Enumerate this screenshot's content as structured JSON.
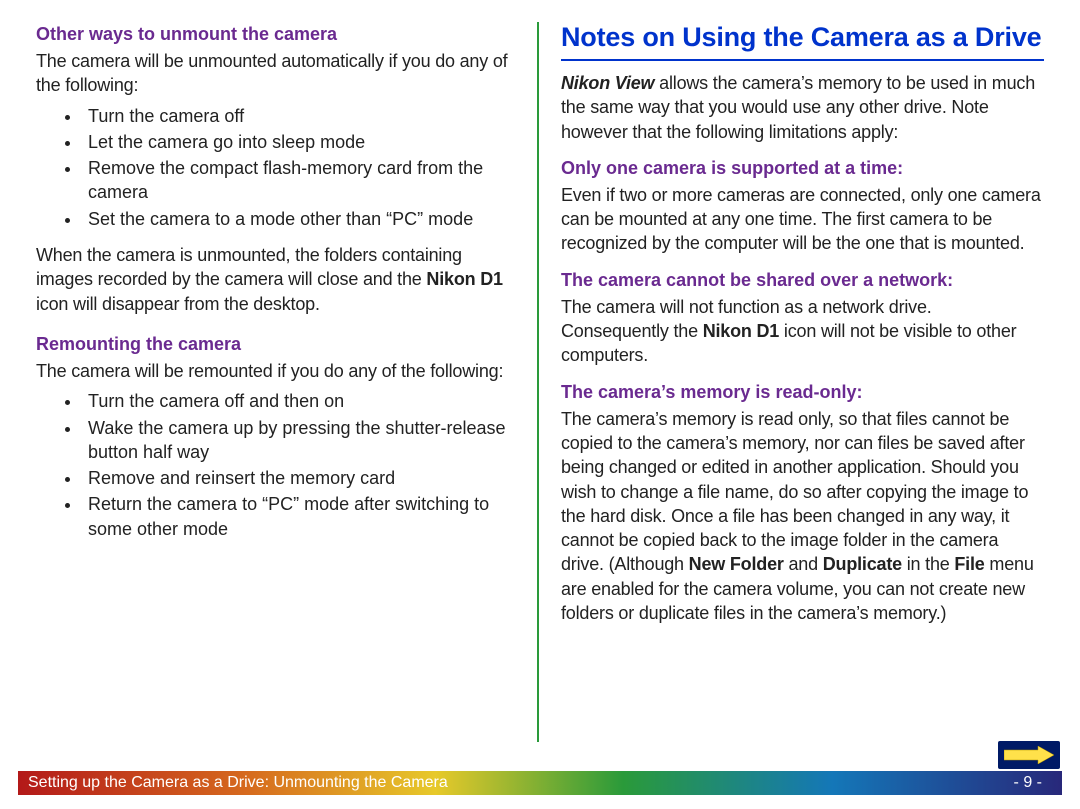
{
  "left": {
    "section1": {
      "heading": "Other ways to unmount the camera",
      "intro": "The camera will be unmounted automatically if you do any of the following:",
      "bullets": [
        "Turn the camera off",
        "Let the camera go into sleep mode",
        "Remove the compact flash-memory card from the camera",
        "Set the camera to a mode other than “PC” mode"
      ],
      "after_pre": "When the camera is unmounted, the folders containing images recorded by the camera will close and the ",
      "after_bold": "Nikon D1",
      "after_post": " icon will disappear from the desktop."
    },
    "section2": {
      "heading": "Remounting the camera",
      "intro": "The camera will be remounted if you do any of the following:",
      "bullets": [
        "Turn the camera off and then on",
        "Wake the camera up by pressing the shutter-release button half way",
        "Remove and reinsert the memory card",
        "Return the camera to “PC” mode after switching to some other mode"
      ]
    }
  },
  "right": {
    "title": "Notes on Using the Camera as a Drive",
    "intro_italic": "Nikon View",
    "intro_rest": " allows the camera’s memory to be used in much the same way that you would use any other drive.  Note however that the following limitations apply:",
    "s1": {
      "heading": "Only one camera is supported at a time:",
      "body": "Even if two or more cameras are connected, only one camera can be mounted at any one time. The first camera to be recognized by the computer will be the one that is mounted."
    },
    "s2": {
      "heading": "The camera cannot be shared over a network:",
      "body_pre": "The camera will not function as a network drive.  Consequently the ",
      "body_bold": "Nikon D1",
      "body_post": " icon will not be visible to other computers."
    },
    "s3": {
      "heading": "The camera’s memory is read-only:",
      "body_pre": "The camera’s memory is read only, so that files cannot be copied to the camera’s memory, nor can files be saved after being changed or edited in another application. Should you wish to change a file name, do so after copying the image to the hard disk. Once a file has been changed in any way, it cannot be copied back to the image folder in the camera drive.  (Although ",
      "body_b1": "New Folder",
      "body_mid1": " and ",
      "body_b2": "Duplicate",
      "body_mid2": " in the ",
      "body_b3": "File",
      "body_post": " menu are enabled for the camera volume, you can not create new folders or duplicate files in the camera’s memory.)"
    }
  },
  "footer": {
    "text": "Setting up the Camera as a Drive:  Unmounting the Camera",
    "page": "- 9 -"
  }
}
